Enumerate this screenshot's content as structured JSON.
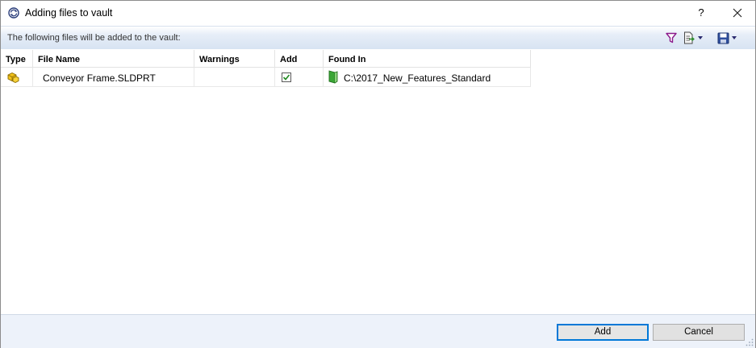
{
  "window": {
    "title": "Adding files to vault",
    "help_label": "?",
    "icons": {
      "app": "vault-refresh-icon",
      "close": "close-icon"
    }
  },
  "infobar": {
    "text": "The following files will be added to the vault:",
    "tools": [
      "filter-icon",
      "export-icon",
      "save-icon"
    ]
  },
  "table": {
    "columns": [
      "Type",
      "File Name",
      "Warnings",
      "Add",
      "Found In"
    ],
    "rows": [
      {
        "type_icon": "part-icon",
        "file_name": "Conveyor Frame.SLDPRT",
        "warnings": "",
        "add_checked": true,
        "found_in": "C:\\2017_New_Features_Standard",
        "found_in_icon": "folder-icon"
      }
    ]
  },
  "buttons": {
    "add": "Add",
    "cancel": "Cancel"
  },
  "colors": {
    "accent": "#0078d7",
    "infobar": "#dfe8f4",
    "footer": "#edf2fa",
    "folder": "#3aa635"
  }
}
